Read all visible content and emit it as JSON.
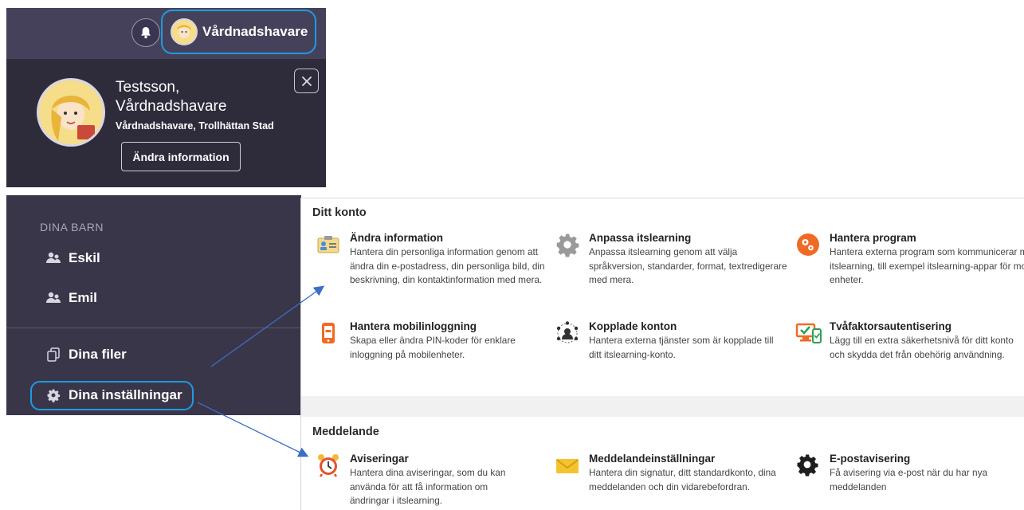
{
  "topbar": {
    "user_label": "Vårdnadshavare"
  },
  "profile": {
    "name_line1": "Testsson,",
    "name_line2": "Vårdnadshavare",
    "role": "Vårdnadshavare, Trollhättan Stad",
    "edit_button": "Ändra information"
  },
  "nav": {
    "children_heading": "DINA BARN",
    "children": [
      "Eskil",
      "Emil"
    ],
    "files_label": "Dina filer",
    "settings_label": "Dina inställningar"
  },
  "settings": {
    "account_section": "Ditt konto",
    "account_cards": [
      {
        "title": "Ändra information",
        "desc": "Hantera din personliga information genom att ändra din e-postadress, din personliga bild, din beskrivning, din kontaktinformation med mera.",
        "icon": "id-card-icon"
      },
      {
        "title": "Anpassa itslearning",
        "desc": "Anpassa itslearning genom att välja språkversion, standarder, format, textredigerare med mera.",
        "icon": "gear-icon"
      },
      {
        "title": "Hantera program",
        "desc": "Hantera externa program som kommunicerar med itslearning, till exempel itslearning-appar för mobila enheter.",
        "icon": "apps-icon"
      },
      {
        "title": "Hantera mobilinloggning",
        "desc": "Skapa eller ändra PIN-koder för enklare inloggning på mobilenheter.",
        "icon": "mobile-icon"
      },
      {
        "title": "Kopplade konton",
        "desc": "Hantera externa tjänster som är kopplade till ditt itslearning-konto.",
        "icon": "connected-accounts-icon"
      },
      {
        "title": "Tvåfaktorsautentisering",
        "desc": "Lägg till en extra säkerhetsnivå för ditt konto och skydda det från obehörig användning.",
        "icon": "two-factor-icon"
      }
    ],
    "message_section": "Meddelande",
    "message_cards": [
      {
        "title": "Aviseringar",
        "desc": "Hantera dina aviseringar, som du kan använda för att få information om ändringar i itslearning.",
        "icon": "alarm-clock-icon"
      },
      {
        "title": "Meddelandeinställningar",
        "desc": "Hantera din signatur, ditt standardkonto, dina meddelanden och din vidarebefordran.",
        "icon": "envelope-icon"
      },
      {
        "title": "E-postavisering",
        "desc": "Få avisering via e-post när du har nya meddelanden",
        "icon": "gear-icon"
      }
    ]
  },
  "colors": {
    "topbar": "#46415a",
    "profile_bg": "#2e2b3b",
    "nav_bg": "#3a3649",
    "highlight": "#1e9be0",
    "arrow": "#3b6fc4"
  }
}
